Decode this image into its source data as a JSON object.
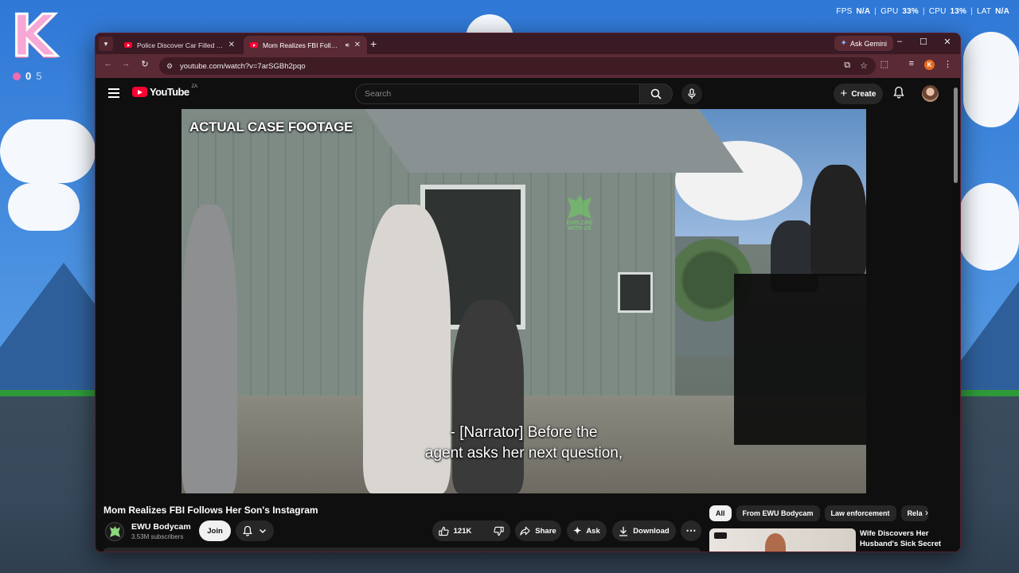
{
  "overlay": {
    "logo_letter": "K",
    "logo_sub": "0",
    "logo_sub2": "5",
    "perf": [
      {
        "label": "FPS",
        "value": "N/A"
      },
      {
        "label": "GPU",
        "value": "33%"
      },
      {
        "label": "CPU",
        "value": "13%"
      },
      {
        "label": "LAT",
        "value": "N/A"
      }
    ]
  },
  "browser": {
    "tabs": [
      {
        "title": "Police Discover Car Filled With",
        "active": false
      },
      {
        "title": "Mom Realizes FBI Follows H",
        "active": true
      }
    ],
    "new_tab": "+",
    "gemini_label": "Ask Gemini",
    "url": "youtube.com/watch?v=7arSGBh2pqo",
    "profile_initial": "K"
  },
  "youtube": {
    "logo_text": "YouTube",
    "country_code": "ZA",
    "search_placeholder": "Search",
    "create_label": "Create",
    "video": {
      "overlay_label": "ACTUAL CASE FOOTAGE",
      "caption_line1": "- [Narrator] Before the",
      "caption_line2": "agent asks her next question,",
      "watermark": "EXPLORE WITH US"
    },
    "title": "Mom Realizes FBI Follows Her Son's Instagram",
    "channel": {
      "name": "EWU Bodycam",
      "subscribers": "3.53M subscribers",
      "join_label": "Join"
    },
    "actions": {
      "likes": "121K",
      "share": "Share",
      "ask": "Ask",
      "download": "Download",
      "more": "⋯"
    },
    "chips": [
      "All",
      "From EWU Bodycam",
      "Law enforcement",
      "Rela"
    ],
    "recommendation": {
      "title": "Wife Discovers Her Husband's Sick Secret"
    }
  },
  "colors": {
    "window_frame": "#5a2a35",
    "youtube_red": "#ff0033",
    "page_bg": "#0f0f0f"
  },
  "icons": [
    "hamburger-icon",
    "search-icon",
    "mic-icon",
    "bell-icon",
    "like-icon",
    "dislike-icon",
    "share-icon",
    "sparkle-icon",
    "download-icon",
    "chevron-right-icon"
  ]
}
